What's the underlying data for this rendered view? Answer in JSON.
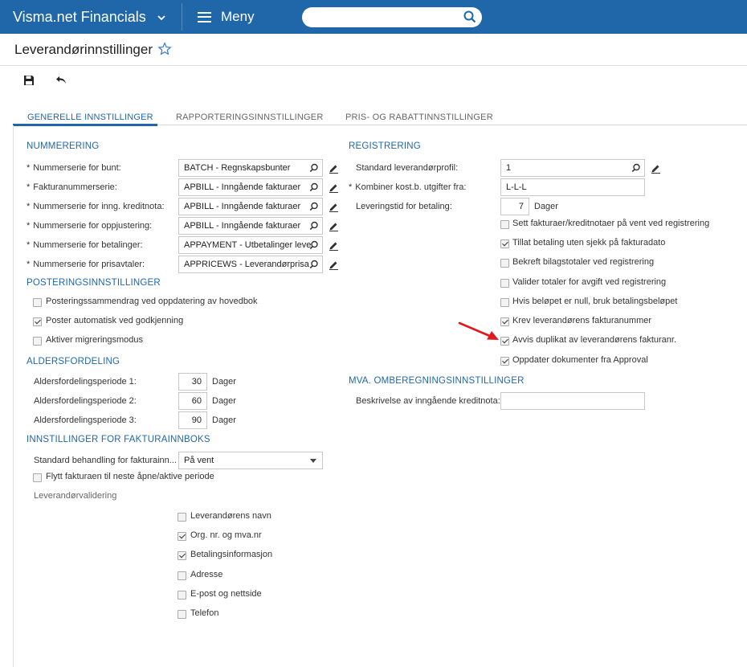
{
  "app": {
    "title": "Visma.net Financials",
    "menu_label": "Meny"
  },
  "search": {
    "placeholder": ""
  },
  "page": {
    "title": "Leverandørinnstillinger"
  },
  "tabs": [
    {
      "label": "GENERELLE INNSTILLINGER"
    },
    {
      "label": "RAPPORTERINGSINNSTILLINGER"
    },
    {
      "label": "PRIS- OG RABATTINNSTILLINGER"
    }
  ],
  "nummerering": {
    "title": "NUMMERERING",
    "rows": [
      {
        "label": "Nummerserie for bunt:",
        "value": "BATCH - Regnskapsbunter"
      },
      {
        "label": "Fakturanummerserie:",
        "value": "APBILL - Inngående fakturaer"
      },
      {
        "label": "Nummerserie for inng. kreditnota:",
        "value": "APBILL - Inngående fakturaer"
      },
      {
        "label": "Nummerserie for oppjustering:",
        "value": "APBILL - Inngående fakturaer"
      },
      {
        "label": "Nummerserie for betalinger:",
        "value": "APPAYMENT - Utbetalinger leve"
      },
      {
        "label": "Nummerserie for prisavtaler:",
        "value": "APPRICEWS - Leverandørprisa"
      }
    ]
  },
  "postering": {
    "title": "POSTERINGSINNSTILLINGER",
    "options": [
      {
        "label": "Posteringssammendrag ved oppdatering av hovedbok",
        "checked": false
      },
      {
        "label": "Poster automatisk ved godkjenning",
        "checked": true
      },
      {
        "label": "Aktiver migreringsmodus",
        "checked": false
      }
    ]
  },
  "alder": {
    "title": "ALDERSFORDELING",
    "unit": "Dager",
    "rows": [
      {
        "label": "Aldersfordelingsperiode 1:",
        "value": "30"
      },
      {
        "label": "Aldersfordelingsperiode 2:",
        "value": "60"
      },
      {
        "label": "Aldersfordelingsperiode 3:",
        "value": "90"
      }
    ]
  },
  "innboks": {
    "title": "INNSTILLINGER FOR FAKTURAINNBOKS",
    "default_label": "Standard behandling for fakturainn...",
    "default_value": "På vent",
    "move_label": "Flytt fakturaen til neste åpne/aktive periode",
    "validation_label": "Leverandørvalidering",
    "validation": [
      {
        "label": "Leverandørens navn",
        "checked": false
      },
      {
        "label": "Org. nr. og mva.nr",
        "checked": true
      },
      {
        "label": "Betalingsinformasjon",
        "checked": true
      },
      {
        "label": "Adresse",
        "checked": false
      },
      {
        "label": "E-post og nettside",
        "checked": false
      },
      {
        "label": "Telefon",
        "checked": false
      }
    ]
  },
  "registrering": {
    "title": "REGISTRERING",
    "profile_label": "Standard leverandørprofil:",
    "profile_value": "1",
    "combine_label": "Kombiner kost.b. utgifter fra:",
    "combine_value": "L-L-L",
    "lead_label": "Leveringstid for betaling:",
    "lead_value": "7",
    "lead_unit": "Dager",
    "options": [
      {
        "label": "Sett fakturaer/kreditnotaer på vent ved registrering",
        "checked": false
      },
      {
        "label": "Tillat betaling uten sjekk på fakturadato",
        "checked": true
      },
      {
        "label": "Bekreft bilagstotaler ved registrering",
        "checked": false
      },
      {
        "label": "Valider totaler for avgift ved registrering",
        "checked": false
      },
      {
        "label": "Hvis beløpet er null, bruk betalingsbeløpet",
        "checked": false
      },
      {
        "label": "Krev leverandørens fakturanummer",
        "checked": true
      },
      {
        "label": "Avvis duplikat av leverandørens fakturanr.",
        "checked": true
      },
      {
        "label": "Oppdater dokumenter fra Approval",
        "checked": true
      }
    ]
  },
  "mva": {
    "title": "MVA. OMBEREGNINGSINNSTILLINGER",
    "desc_label": "Beskrivelse av inngående kreditnota:",
    "desc_value": ""
  },
  "colors": {
    "brand": "#1f67a8",
    "arrow": "#e0191e"
  }
}
